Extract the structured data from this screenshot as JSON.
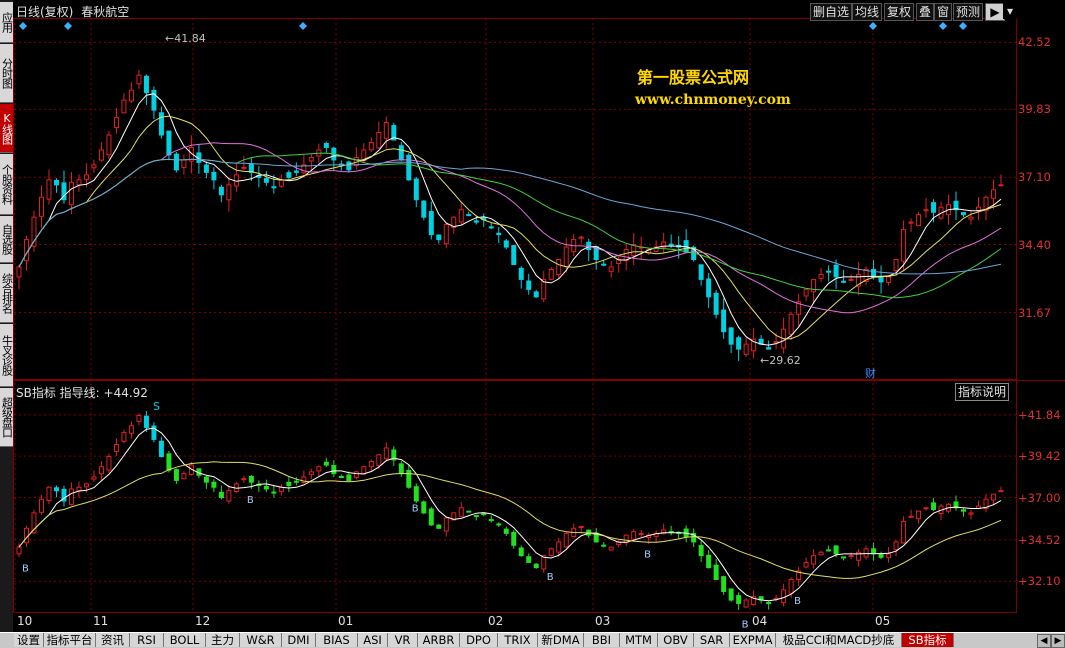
{
  "left_nav": [
    {
      "label": "应用"
    },
    {
      "label": "分时图"
    },
    {
      "label": "K线图",
      "active": true
    },
    {
      "label": "个股资料"
    },
    {
      "label": "自选股"
    },
    {
      "label": "综合排名"
    },
    {
      "label": "牛叉诊股"
    },
    {
      "label": "超级盘口"
    }
  ],
  "header": {
    "period": "日线(复权)",
    "stock_name": "春秋航空"
  },
  "toolbar": [
    {
      "label": "删自选"
    },
    {
      "label": "均线"
    },
    {
      "label": "复权"
    },
    {
      "label": "叠"
    },
    {
      "label": "窗"
    },
    {
      "label": "预测"
    }
  ],
  "watermark": {
    "title": "第一股票公式网",
    "url": "www.chnmoney.com"
  },
  "main_chart": {
    "y_ticks": [
      "42.52",
      "39.83",
      "37.10",
      "34.40",
      "31.67"
    ],
    "high_label": "41.84",
    "low_label": "29.62",
    "cai_marker": "财"
  },
  "indicator": {
    "title": "SB指标 指导线: +44.92",
    "help_button": "指标说明",
    "y_ticks": [
      "+41.84",
      "+39.42",
      "+37.00",
      "+34.52",
      "+32.10"
    ],
    "signal_s": "S",
    "signal_b": "B"
  },
  "x_axis_months": [
    "10",
    "11",
    "12",
    "01",
    "02",
    "03",
    "04",
    "05"
  ],
  "tabs": [
    {
      "label": "设置"
    },
    {
      "label": "指标平台"
    },
    {
      "label": "资讯"
    },
    {
      "label": "RSI"
    },
    {
      "label": "BOLL"
    },
    {
      "label": "主力"
    },
    {
      "label": "W&R"
    },
    {
      "label": "DMI"
    },
    {
      "label": "BIAS"
    },
    {
      "label": "ASI"
    },
    {
      "label": "VR"
    },
    {
      "label": "ARBR"
    },
    {
      "label": "DPO"
    },
    {
      "label": "TRIX"
    },
    {
      "label": "新DMA"
    },
    {
      "label": "BBI"
    },
    {
      "label": "MTM"
    },
    {
      "label": "OBV"
    },
    {
      "label": "SAR"
    },
    {
      "label": "EXPMA"
    },
    {
      "label": "极品CCI和MACD抄底"
    },
    {
      "label": "SB指标",
      "active": true
    }
  ],
  "colors": {
    "up": "#e02020",
    "down": "#00d0e0",
    "ind_down": "#20e020",
    "grid": "#800000",
    "ma_blue": "#6aa6d8"
  },
  "chart_data": {
    "type": "candlestick",
    "title": "日线(复权) 春秋航空",
    "ylim": [
      29.0,
      43.5
    ],
    "x_ticks": [
      "10",
      "11",
      "12",
      "01",
      "02",
      "03",
      "04",
      "05"
    ],
    "high": 41.84,
    "low": 29.62,
    "close_series": [
      33.5,
      34.6,
      35.5,
      36.3,
      37.0,
      36.8,
      36.2,
      36.9,
      37.0,
      37.2,
      37.6,
      38.2,
      38.8,
      39.5,
      40.2,
      40.6,
      41.2,
      40.5,
      39.8,
      38.8,
      38.0,
      37.4,
      37.8,
      38.3,
      37.7,
      37.3,
      37.0,
      36.4,
      36.8,
      37.2,
      37.5,
      37.3,
      37.1,
      36.9,
      36.7,
      37.0,
      37.1,
      37.3,
      37.6,
      37.9,
      38.2,
      38.3,
      37.8,
      37.6,
      37.4,
      37.9,
      38.2,
      38.5,
      38.9,
      39.3,
      38.6,
      37.8,
      37.0,
      36.2,
      35.5,
      34.8,
      34.6,
      35.2,
      35.5,
      35.8,
      35.6,
      35.3,
      35.4,
      35.1,
      34.8,
      34.3,
      33.6,
      33.0,
      32.6,
      32.3,
      33.0,
      33.4,
      33.8,
      34.3,
      34.6,
      34.7,
      34.2,
      33.8,
      33.6,
      33.5,
      33.8,
      34.2,
      34.4,
      34.3,
      34.2,
      34.3,
      34.5,
      34.4,
      34.3,
      34.1,
      33.8,
      33.0,
      32.3,
      31.6,
      30.9,
      30.4,
      30.2,
      30.4,
      30.6,
      30.4,
      30.2,
      30.5,
      31.0,
      31.6,
      32.1,
      32.6,
      33.0,
      33.2,
      33.3,
      33.1,
      32.9,
      33.0,
      33.2,
      33.4,
      33.1,
      32.9,
      33.1,
      33.8,
      35.0,
      35.3,
      35.6,
      35.8,
      35.7,
      35.9,
      36.0,
      35.8,
      35.6,
      35.5,
      35.9,
      36.3,
      36.6,
      36.8
    ],
    "series": [
      {
        "name": "MA5",
        "color": "#ffffff"
      },
      {
        "name": "MA10",
        "color": "#e0e060"
      },
      {
        "name": "MA20",
        "color": "#e070e0"
      },
      {
        "name": "MA30",
        "color": "#40d040"
      },
      {
        "name": "MA60",
        "color": "#6aa6d8"
      }
    ]
  }
}
